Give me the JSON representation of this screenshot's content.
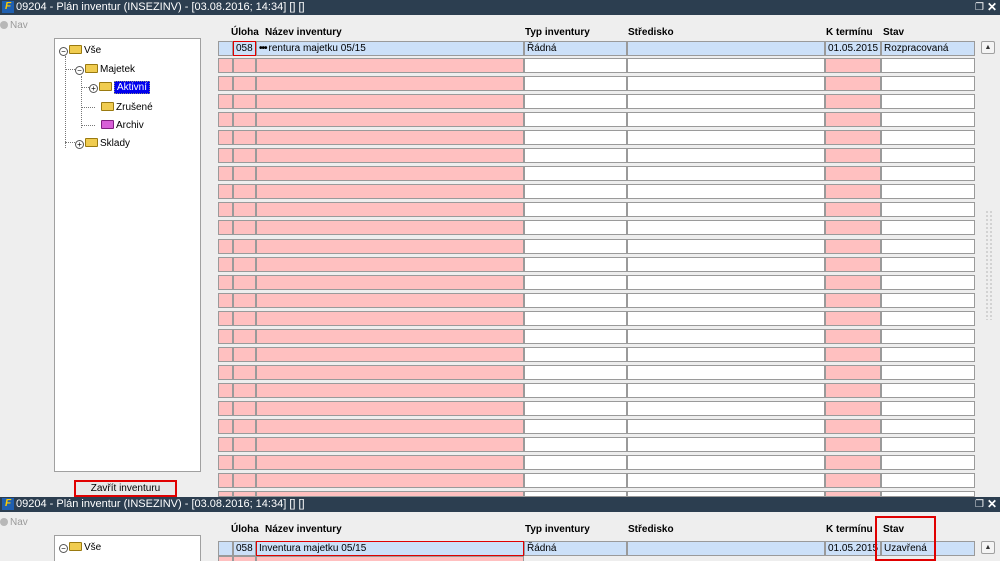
{
  "window1": {
    "title": "09204 - Plán inventur (INSEZINV) - [03.08.2016; 14:34] [] []",
    "logo": "F",
    "nav_label": "Nav",
    "tree": {
      "root": "Vše",
      "majetek": "Majetek",
      "aktivni": "Aktivní",
      "zrusene": "Zrušené",
      "archiv": "Archiv",
      "sklady": "Sklady"
    },
    "close_button": "Zavřít inventuru",
    "columns": {
      "uloha": "Úloha",
      "nazev": "Název inventury",
      "typ": "Typ inventury",
      "stredisko": "Středisko",
      "termin": "K termínu",
      "stav": "Stav"
    },
    "row": {
      "uloha": "058",
      "dots": "•••",
      "nazev": "rentura majetku 05/15",
      "typ": "Řádná",
      "stredisko": "",
      "termin": "01.05.2015",
      "stav": "Rozpracovaná"
    }
  },
  "window2": {
    "title": "09204 - Plán inventur (INSEZINV) - [03.08.2016; 14:34] [] []",
    "logo": "F",
    "nav_label": "Nav",
    "tree": {
      "root": "Vše"
    },
    "columns": {
      "uloha": "Úloha",
      "nazev": "Název inventury",
      "typ": "Typ inventury",
      "stredisko": "Středisko",
      "termin": "K termínu",
      "stav": "Stav"
    },
    "row": {
      "uloha": "058",
      "nazev": "Inventura majetku 05/15",
      "typ": "Řádná",
      "stredisko": "",
      "termin": "01.05.2015",
      "stav": "Uzavřená"
    }
  },
  "colors": {
    "titlebar": "#2c3e50",
    "selected_row": "#cce0f8",
    "required_cell": "#ffc0c0",
    "highlight": "#e00000",
    "tree_selection": "#0000ee"
  },
  "icons": [
    "app-logo-icon",
    "restore-icon",
    "close-icon",
    "nav-icon",
    "folder-icon",
    "expand-icon",
    "scroll-up-icon"
  ]
}
